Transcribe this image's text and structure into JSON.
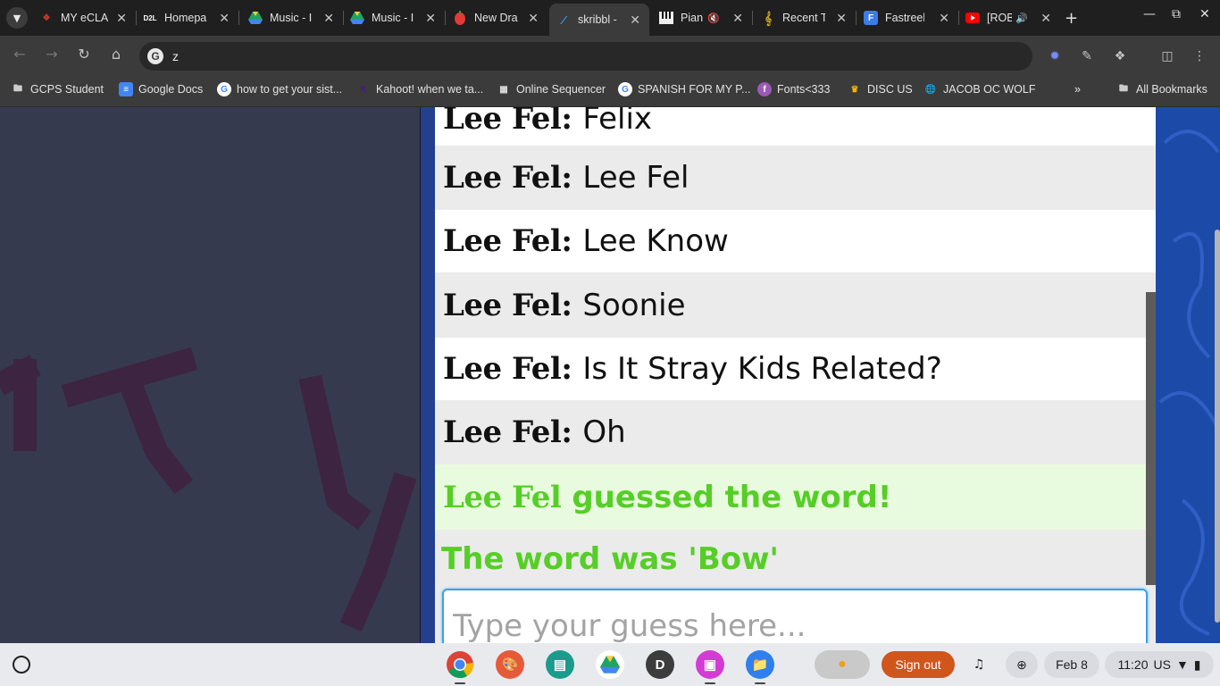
{
  "browser": {
    "tabs": [
      {
        "title": "MY eCLA",
        "icon": "eclass-icon",
        "color": "#c0392b"
      },
      {
        "title": "Homepa",
        "icon": "d2l-icon",
        "color": "#222222"
      },
      {
        "title": "Music - I",
        "icon": "google-drive-icon",
        "color": "#1fa463"
      },
      {
        "title": "Music - I",
        "icon": "google-drive-icon",
        "color": "#1fa463"
      },
      {
        "title": "New Dra",
        "icon": "drawing-icon",
        "color": "#e53935"
      },
      {
        "title": "skribbl -",
        "icon": "skribbl-icon",
        "color": "#3aa0f0",
        "active": true
      },
      {
        "title": "Pian",
        "icon": "piano-icon",
        "color": "#e0e0e0",
        "muted": true
      },
      {
        "title": "Recent T",
        "icon": "treble-clef-icon",
        "color": "#c9a227"
      },
      {
        "title": "Fastreel",
        "icon": "fastreel-icon",
        "color": "#3a7de8"
      },
      {
        "title": "[ROB",
        "icon": "youtube-icon",
        "color": "#ff0000",
        "playing": true
      }
    ],
    "omnibox_value": "z",
    "bookmarks": [
      {
        "label": "GCPS Student",
        "icon": "folder-icon"
      },
      {
        "label": "Google Docs",
        "icon": "google-docs-icon"
      },
      {
        "label": "how to get your sist...",
        "icon": "google-icon"
      },
      {
        "label": "Kahoot! when we ta...",
        "icon": "kahoot-icon"
      },
      {
        "label": "Online Sequencer",
        "icon": "sequencer-icon"
      },
      {
        "label": "SPANISH FOR MY P...",
        "icon": "google-icon"
      },
      {
        "label": "Fonts<333",
        "icon": "fonts-icon"
      },
      {
        "label": "DISC US",
        "icon": "crown-icon"
      },
      {
        "label": "JACOB OC WOLF",
        "icon": "globe-icon"
      }
    ],
    "all_bookmarks": "All Bookmarks"
  },
  "chat": {
    "messages": [
      {
        "user": "Lee Fel:",
        "text": "Felix"
      },
      {
        "user": "Lee Fel:",
        "text": "Lee Fel"
      },
      {
        "user": "Lee Fel:",
        "text": "Lee Know"
      },
      {
        "user": "Lee Fel:",
        "text": "Soonie"
      },
      {
        "user": "Lee Fel:",
        "text": "Is It Stray Kids Related?"
      },
      {
        "user": "Lee Fel:",
        "text": "Oh"
      }
    ],
    "guess_notice": {
      "user": "Lee Fel",
      "text": "guessed the word!"
    },
    "word_reveal": "The word was 'Bow'",
    "input_placeholder": "Type your guess here...",
    "colors": {
      "correct": "#56ce27",
      "input_border": "#3aa0f0"
    }
  },
  "shelf": {
    "apps": [
      {
        "name": "Chrome",
        "icon": "chrome-icon"
      },
      {
        "name": "Paint",
        "icon": "palette-icon"
      },
      {
        "name": "Classroom",
        "icon": "classroom-icon"
      },
      {
        "name": "Drive",
        "icon": "google-drive-icon"
      },
      {
        "name": "D",
        "icon": "d-letter-icon"
      },
      {
        "name": "Canvas",
        "icon": "canvas-icon"
      },
      {
        "name": "Files",
        "icon": "files-icon"
      }
    ],
    "sign_out": "Sign out",
    "date": "Feb 8",
    "time": "11:20",
    "locale": "US"
  }
}
